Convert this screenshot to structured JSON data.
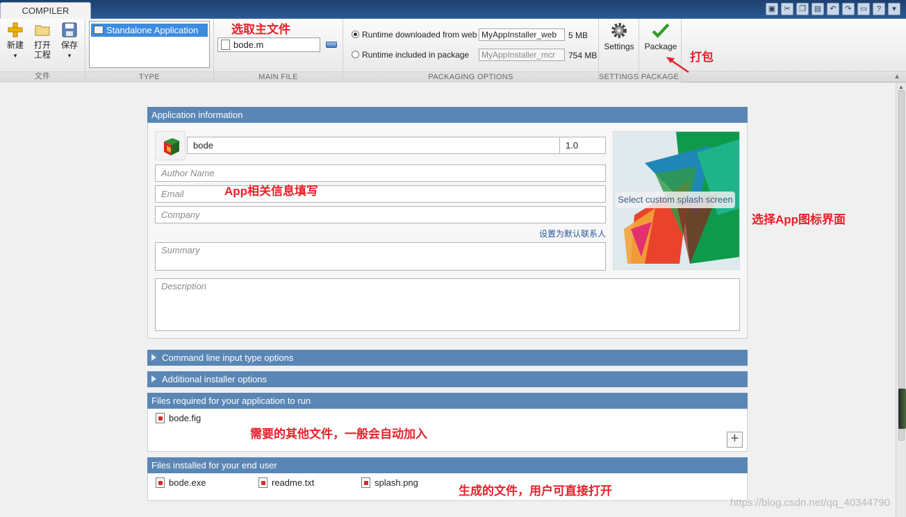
{
  "window": {
    "tab_label": "COMPILER",
    "quick_access_icons": [
      "save-icon",
      "cut-icon",
      "copy-icon",
      "paste-icon",
      "undo-icon",
      "redo-icon",
      "window-icon",
      "help-icon",
      "dropdown-icon"
    ]
  },
  "ribbon": {
    "file_section": {
      "new_label": "新建",
      "open_label_line1": "打开",
      "open_label_line2": "工程",
      "save_label": "保存",
      "section_label": "文件"
    },
    "type_section": {
      "selected_type": "Standalone Application",
      "section_label": "TYPE"
    },
    "main_file_section": {
      "file": "bode.m",
      "section_label": "MAIN FILE"
    },
    "packaging_options": {
      "option_web_label": "Runtime downloaded from web",
      "option_web_name": "MyAppInstaller_web",
      "option_web_size": "5 MB",
      "option_pkg_label": "Runtime included in package",
      "option_pkg_name": "MyAppInstaller_mcr",
      "option_pkg_size": "754 MB",
      "selected": "web",
      "section_label": "PACKAGING OPTIONS"
    },
    "settings_section": {
      "button_label": "Settings",
      "section_label": "SETTINGS"
    },
    "package_section": {
      "button_label": "Package",
      "section_label": "PACKAGE"
    }
  },
  "annotations": {
    "main_file": "选取主文件",
    "package": "打包",
    "app_info": "App相关信息填写",
    "splash": "选择App图标界面",
    "required_files": "需要的其他文件，一般会自动加入",
    "installed_files": "生成的文件，用户可直接打开"
  },
  "app_info": {
    "header": "Application information",
    "app_name": "bode",
    "version": "1.0",
    "author_placeholder": "Author Name",
    "email_placeholder": "Email",
    "company_placeholder": "Company",
    "default_contact_link": "设置为默认联系人",
    "summary_placeholder": "Summary",
    "description_placeholder": "Description",
    "splash_button": "Select custom splash screen"
  },
  "sections": {
    "command_line": "Command line input type options",
    "installer": "Additional installer options",
    "required_header": "Files required for your application to run",
    "required_files": [
      "bode.fig"
    ],
    "installed_header": "Files installed for your end user",
    "installed_files": [
      "bode.exe",
      "readme.txt",
      "splash.png"
    ]
  },
  "watermark": "https://blog.csdn.net/qq_40344790"
}
